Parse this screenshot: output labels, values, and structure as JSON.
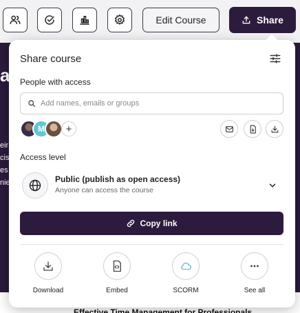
{
  "toolbar": {
    "edit_label": "Edit Course",
    "share_label": "Share",
    "icons": [
      "users-icon",
      "check-circle-icon",
      "bar-chart-icon",
      "gear-icon"
    ]
  },
  "background": {
    "heading_fragment": "a",
    "text_fragments": [
      "eir",
      "cis",
      "es",
      "nie"
    ],
    "card_title": "Effective Time Management for Professionals"
  },
  "share_panel": {
    "title": "Share course",
    "people_label": "People with access",
    "search_placeholder": "Add names, emails or groups",
    "avatar_initial": "M",
    "add_symbol": "+",
    "access_level_label": "Access level",
    "access": {
      "title": "Public (publish as open access)",
      "subtitle": "Anyone can access the course"
    },
    "copy_link_label": "Copy link",
    "options": [
      {
        "label": "Download",
        "icon": "download-icon"
      },
      {
        "label": "Embed",
        "icon": "embed-icon"
      },
      {
        "label": "SCORM",
        "icon": "cloud-icon"
      },
      {
        "label": "See all",
        "icon": "more-icon"
      }
    ]
  },
  "colors": {
    "brand_dark": "#2d1b3d",
    "accent_teal": "#5fc7d6"
  }
}
